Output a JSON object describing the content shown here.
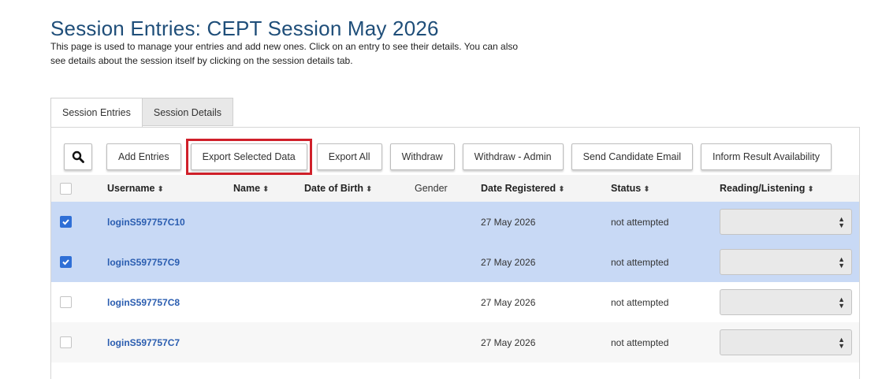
{
  "page": {
    "title": "Session Entries: CEPT Session May 2026",
    "intro": "This page is used to manage your entries and add new ones. Click on an entry to see their details. You can also see details about the session itself by clicking on the session details tab."
  },
  "tabs": [
    {
      "label": "Session Entries",
      "active": true
    },
    {
      "label": "Session Details",
      "active": false
    }
  ],
  "toolbar": {
    "search_icon": "search-icon",
    "buttons": [
      "Add Entries",
      "Export Selected Data",
      "Export All",
      "Withdraw",
      "Withdraw - Admin",
      "Send Candidate Email",
      "Inform Result Availability"
    ],
    "highlighted": "Export Selected Data",
    "highlight_color": "#d0202a"
  },
  "table": {
    "columns": [
      "Username",
      "Name",
      "Date of Birth",
      "Gender",
      "Date Registered",
      "Status",
      "Reading/Listening"
    ],
    "rows": [
      {
        "selected": true,
        "username": "loginS597757C10",
        "name": "",
        "dob": "",
        "gender": "",
        "date_registered": "27 May 2026",
        "status": "not attempted",
        "reading_listening": ""
      },
      {
        "selected": true,
        "username": "loginS597757C9",
        "name": "",
        "dob": "",
        "gender": "",
        "date_registered": "27 May 2026",
        "status": "not attempted",
        "reading_listening": ""
      },
      {
        "selected": false,
        "username": "loginS597757C8",
        "name": "",
        "dob": "",
        "gender": "",
        "date_registered": "27 May 2026",
        "status": "not attempted",
        "reading_listening": ""
      },
      {
        "selected": false,
        "username": "loginS597757C7",
        "name": "",
        "dob": "",
        "gender": "",
        "date_registered": "27 May 2026",
        "status": "not attempted",
        "reading_listening": ""
      }
    ],
    "selected_row_color": "#c8d9f5",
    "link_color": "#2a5db0"
  }
}
